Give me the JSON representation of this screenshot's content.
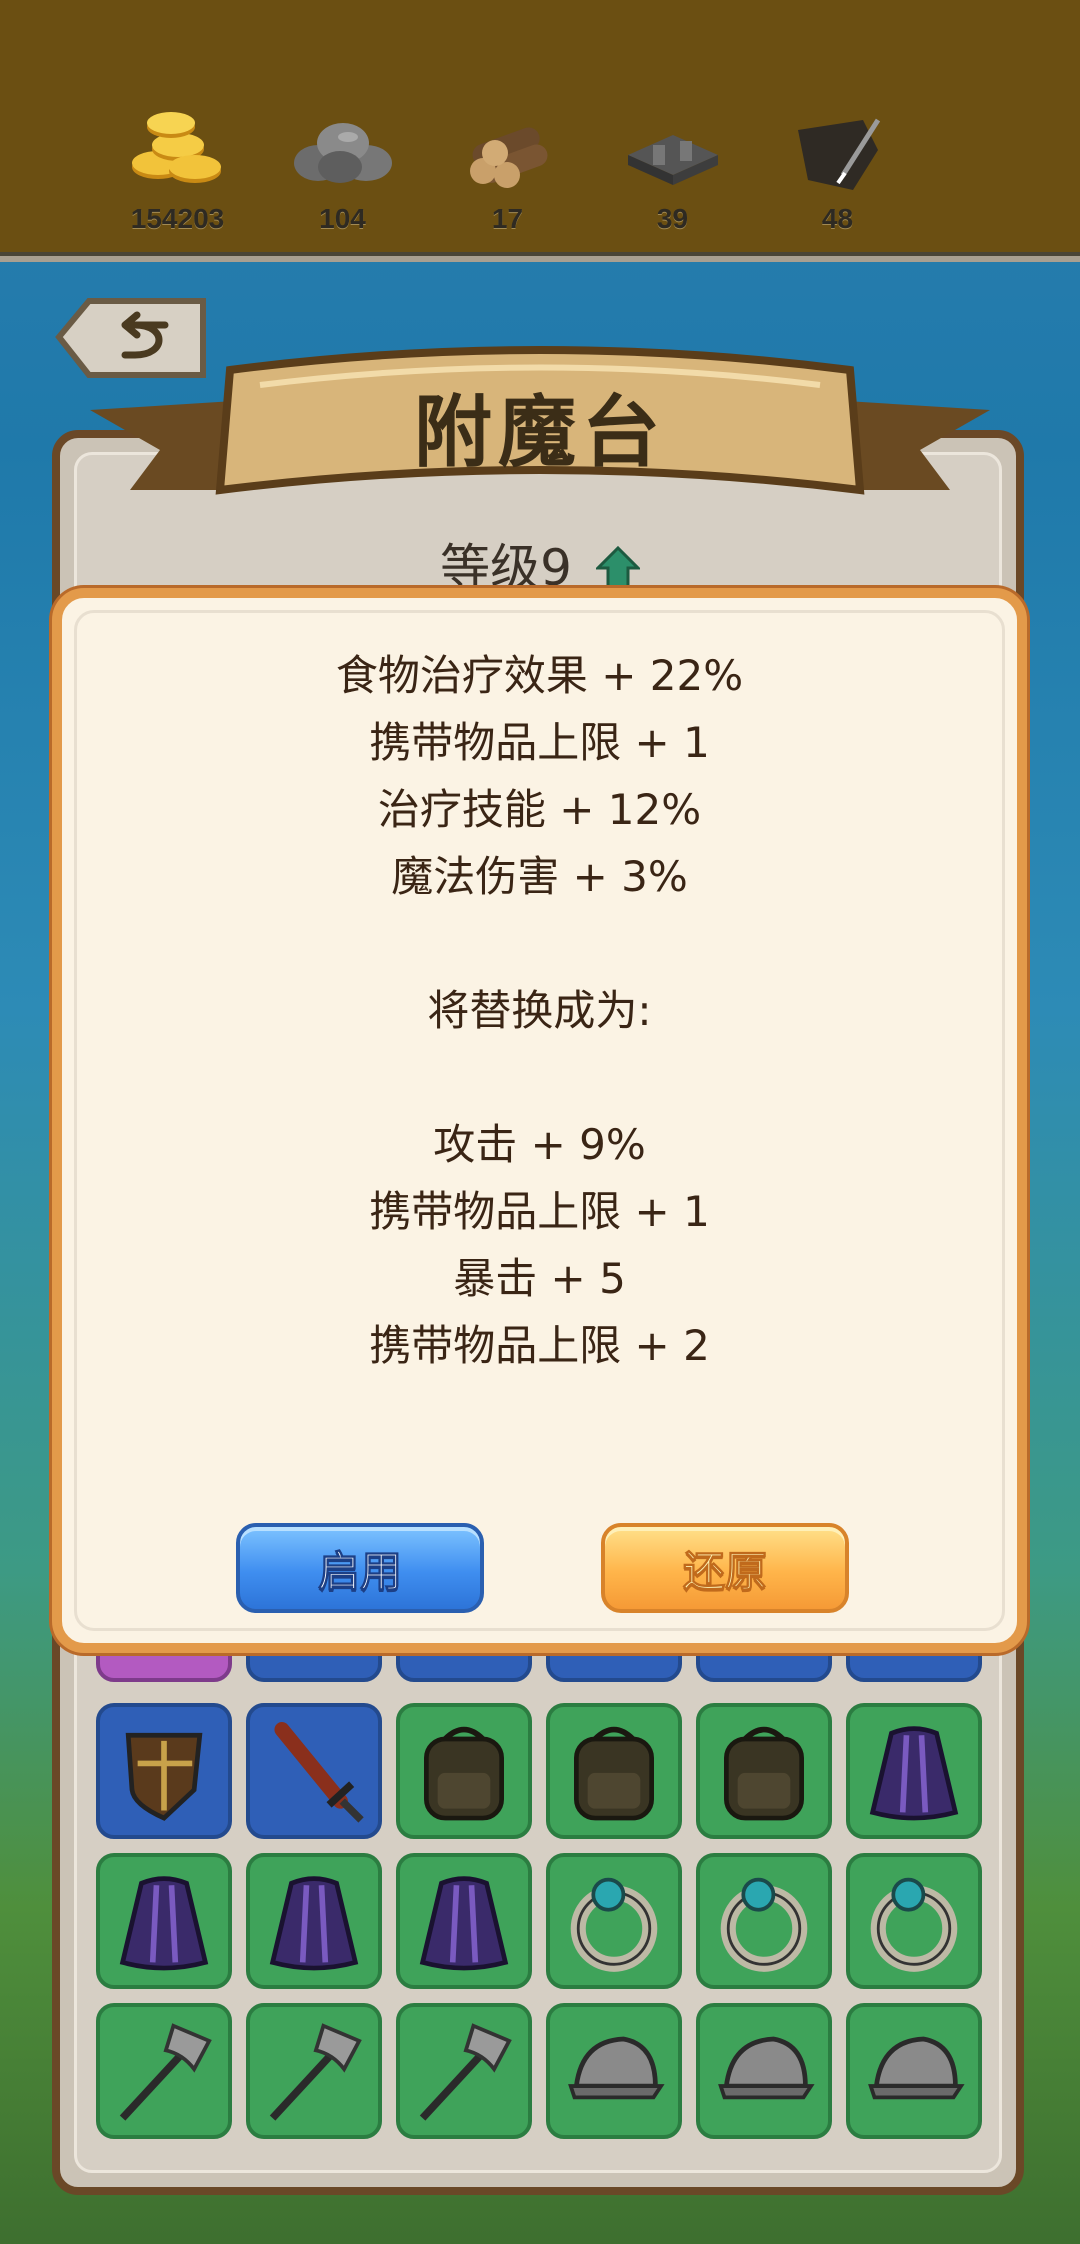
{
  "resources": [
    {
      "icon": "gold-coins-icon",
      "count": "154203"
    },
    {
      "icon": "stone-icon",
      "count": "104"
    },
    {
      "icon": "wood-logs-icon",
      "count": "17"
    },
    {
      "icon": "iron-ingot-icon",
      "count": "39"
    },
    {
      "icon": "leather-icon",
      "count": "48"
    }
  ],
  "title": "附魔台",
  "level": {
    "label": "等级9",
    "icon": "upgrade-arrow-icon"
  },
  "dialog": {
    "current_lines": [
      "食物治疗效果 + 22%",
      "携带物品上限 + 1",
      "治疗技能 + 12%",
      "魔法伤害 + 3%"
    ],
    "replace_text": "将替换成为:",
    "new_lines": [
      "攻击 + 9%",
      "携带物品上限 + 1",
      "暴击 + 5",
      "携带物品上限 + 2"
    ],
    "enable_label": "启用",
    "restore_label": "还原"
  },
  "grid": {
    "partial_row": [
      "purple",
      "blue",
      "blue",
      "blue",
      "blue",
      "blue"
    ],
    "rows": [
      [
        {
          "color": "blue",
          "icon": "shield-icon"
        },
        {
          "color": "blue",
          "icon": "sword-icon"
        },
        {
          "color": "green",
          "icon": "backpack-icon"
        },
        {
          "color": "green",
          "icon": "backpack-icon"
        },
        {
          "color": "green",
          "icon": "backpack-icon"
        },
        {
          "color": "green",
          "icon": "cape-icon"
        }
      ],
      [
        {
          "color": "green",
          "icon": "cape-icon"
        },
        {
          "color": "green",
          "icon": "cape-icon"
        },
        {
          "color": "green",
          "icon": "cape-icon"
        },
        {
          "color": "green",
          "icon": "ring-icon"
        },
        {
          "color": "green",
          "icon": "ring-icon"
        },
        {
          "color": "green",
          "icon": "ring-icon"
        }
      ],
      [
        {
          "color": "green",
          "icon": "axe-icon"
        },
        {
          "color": "green",
          "icon": "axe-icon"
        },
        {
          "color": "green",
          "icon": "axe-icon"
        },
        {
          "color": "green",
          "icon": "helmet-icon"
        },
        {
          "color": "green",
          "icon": "helmet-icon"
        },
        {
          "color": "green",
          "icon": "helmet-icon"
        }
      ]
    ]
  }
}
